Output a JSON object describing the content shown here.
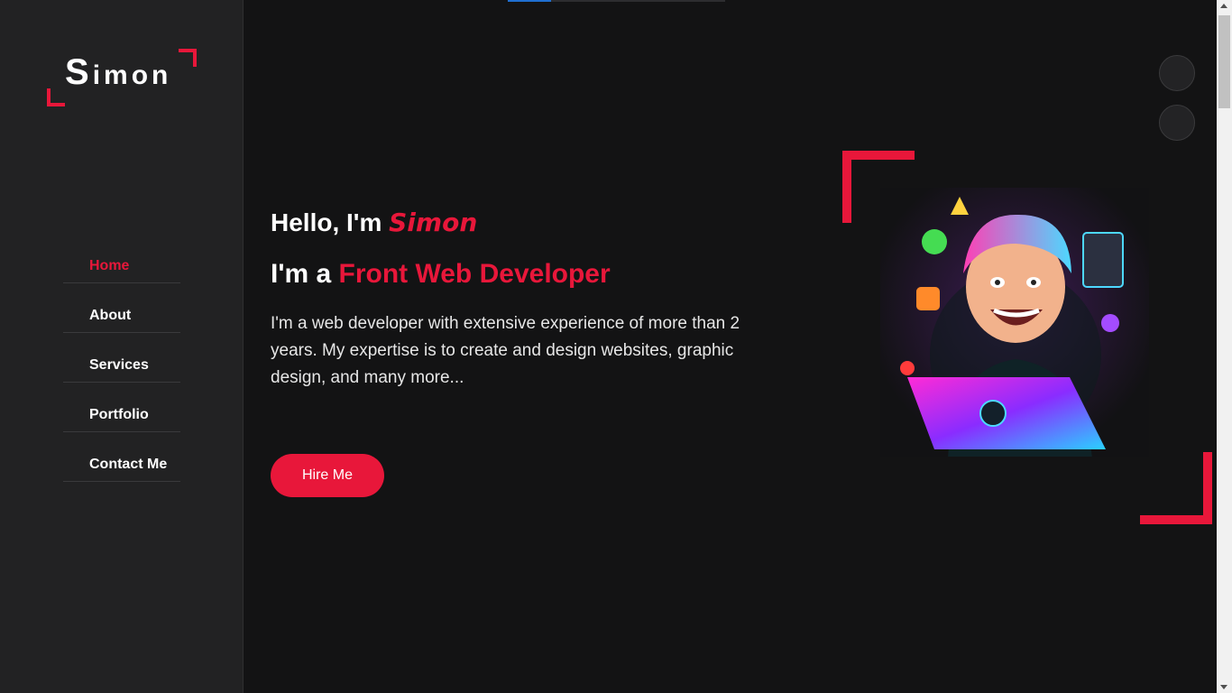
{
  "brand": {
    "logo_first": "S",
    "logo_rest": "imon"
  },
  "nav": {
    "items": [
      {
        "label": "Home"
      },
      {
        "label": "About"
      },
      {
        "label": "Services"
      },
      {
        "label": "Portfolio"
      },
      {
        "label": "Contact Me"
      }
    ]
  },
  "hero": {
    "greeting_prefix": "Hello, I'm ",
    "greeting_name": "Simon",
    "role_prefix": "I'm a ",
    "role_title": "Front Web Developer",
    "description": "I'm a web developer with extensive experience of more than 2 years. My expertise is to create and design websites, graphic design, and many more...",
    "button_label": "Hire Me"
  },
  "colors": {
    "accent": "#e8173a",
    "background": "#131314",
    "sidebar": "#222223"
  },
  "icons": {
    "portrait": "developer-portrait-illustration"
  }
}
